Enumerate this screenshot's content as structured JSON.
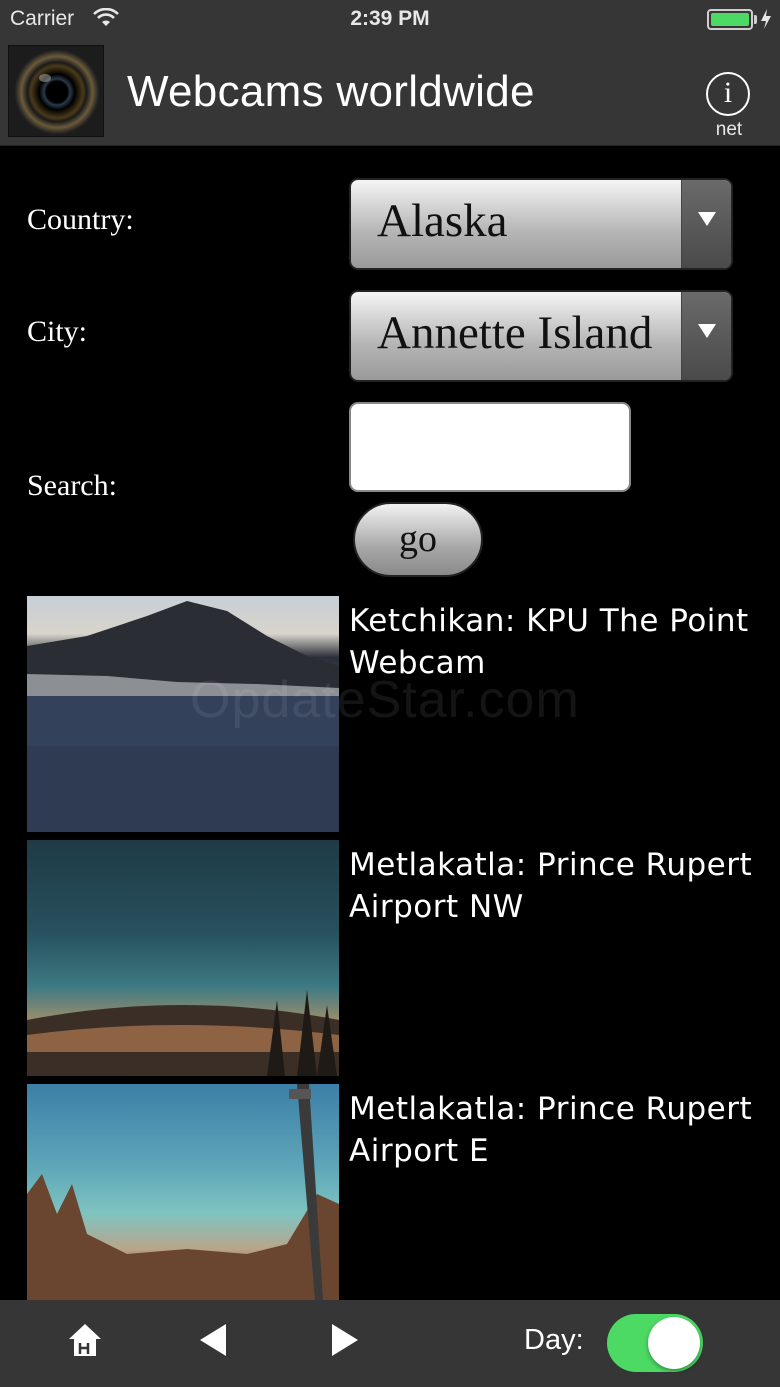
{
  "status_bar": {
    "carrier": "Carrier",
    "time": "2:39 PM"
  },
  "header": {
    "title": "Webcams worldwide",
    "info_glyph": "i",
    "net_label": "net"
  },
  "form": {
    "country_label": "Country:",
    "country_value": "Alaska",
    "city_label": "City:",
    "city_value": "Annette Island",
    "search_label": "Search:",
    "search_value": "",
    "go_label": "go"
  },
  "webcams": [
    {
      "title": "Ketchikan: KPU The Point Webcam"
    },
    {
      "title": "Metlakatla: Prince Rupert Airport NW"
    },
    {
      "title": "Metlakatla: Prince Rupert Airport E"
    }
  ],
  "watermark": "OpdateStar.com",
  "toolbar": {
    "day_label": "Day:",
    "day_toggle_on": true
  },
  "colors": {
    "toggle_on": "#4cd964",
    "bar_bg": "#363636",
    "battery": "#4cd964"
  },
  "icons": [
    "wifi-icon",
    "battery-icon",
    "camera-lens-icon",
    "info-icon",
    "chevron-down-icon",
    "home-icon",
    "back-arrow-icon",
    "forward-arrow-icon"
  ]
}
